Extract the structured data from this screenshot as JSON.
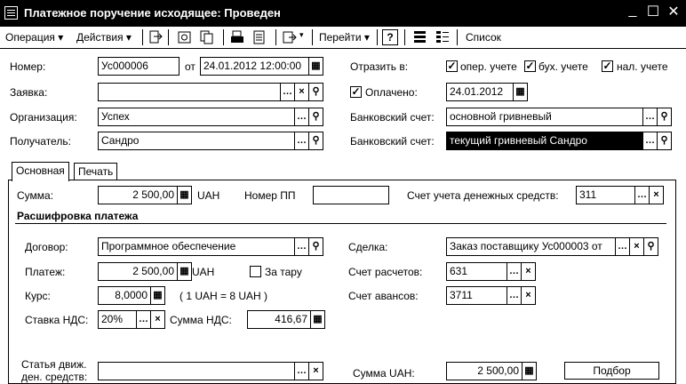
{
  "window": {
    "title": "Платежное поручение исходящее: Проведен",
    "minimize": "_",
    "maximize": "☐",
    "close": "✕"
  },
  "toolbar": {
    "operation": "Операция ▾",
    "actions": "Действия ▾",
    "goto": "Перейти ▾",
    "help": "?",
    "list": "Список"
  },
  "header": {
    "number_label": "Номер:",
    "number_value": "Ус000006",
    "from_label": "от",
    "date_value": "24.01.2012 12:00:00",
    "reflect_label": "Отразить в:",
    "oper_label": "опер. учете",
    "buh_label": "бух. учете",
    "nal_label": "нал. учете",
    "request_label": "Заявка:",
    "request_value": "",
    "paid_label": "Оплачено:",
    "paid_date": "24.01.2012",
    "org_label": "Организация:",
    "org_value": "Успех",
    "bank_label": "Банковский счет:",
    "bank_value": "основной гривневый",
    "recipient_label": "Получатель:",
    "recipient_value": "Сандро",
    "bank2_label": "Банковский счет:",
    "bank2_value": "текущий гривневый Сандро"
  },
  "tabs": {
    "main": "Основная",
    "print": "Печать"
  },
  "main": {
    "sum_label": "Сумма:",
    "sum_value": "2 500,00",
    "currency": "UAH",
    "pp_label": "Номер ПП",
    "pp_value": "",
    "account_label": "Счет учета денежных средств:",
    "account_value": "311",
    "section_title": "Расшифровка платежа",
    "contract_label": "Договор:",
    "contract_value": "Программное обеспечение",
    "deal_label": "Сделка:",
    "deal_value": "Заказ поставщику Ус000003 от",
    "payment_label": "Платеж:",
    "payment_value": "2 500,00",
    "payment_currency": "UAH",
    "tare_label": "За тару",
    "settle_label": "Счет расчетов:",
    "settle_value": "631",
    "rate_label": "Курс:",
    "rate_value": "8,0000",
    "rate_note": "( 1 UAH = 8 UAH )",
    "advance_label": "Счет авансов:",
    "advance_value": "3711",
    "vat_rate_label": "Ставка НДС:",
    "vat_rate_value": "20%",
    "vat_sum_label": "Сумма НДС:",
    "vat_sum_value": "416,67",
    "cash_item_label_1": "Статья движ.",
    "cash_item_label_2": "ден. средств:",
    "cash_item_value": "",
    "sum_uah_label": "Сумма UAH:",
    "sum_uah_value": "2 500,00",
    "select_button": "Подбор"
  }
}
